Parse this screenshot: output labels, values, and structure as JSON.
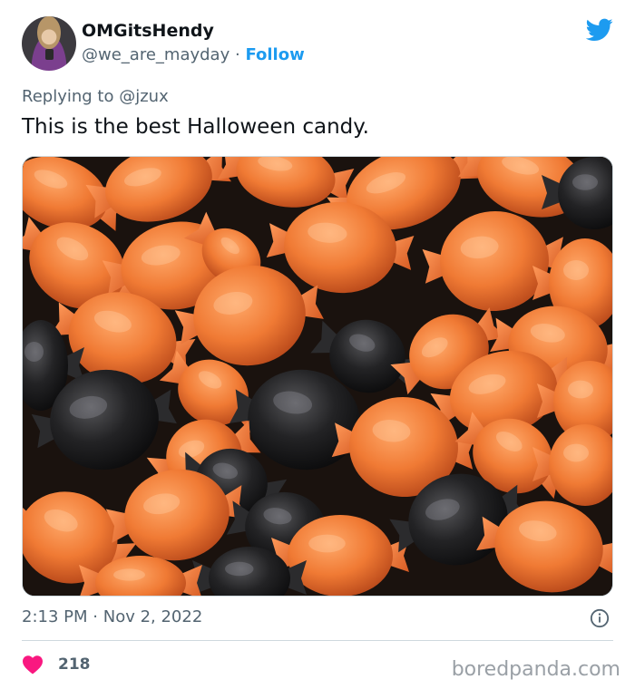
{
  "author": {
    "display_name": "OMGitsHendy",
    "handle": "@we_are_mayday",
    "separator": "·",
    "follow_label": "Follow",
    "avatar_icon": "profile-avatar"
  },
  "brand": {
    "logo_icon": "twitter-bird-icon",
    "color": "#1d9bf0"
  },
  "reply": {
    "prefix": "Replying to",
    "mention": "@jzux"
  },
  "tweet": {
    "text": "This is the best Halloween candy.",
    "media_description_icon": "photo-orange-black-wrapped-candies"
  },
  "meta": {
    "time": "2:13 PM",
    "separator": "·",
    "date": "Nov 2, 2022",
    "info_icon": "info-icon"
  },
  "engagement": {
    "like_icon": "heart-icon",
    "like_color": "#f91880",
    "like_count": "218"
  },
  "watermark": "boredpanda.com"
}
